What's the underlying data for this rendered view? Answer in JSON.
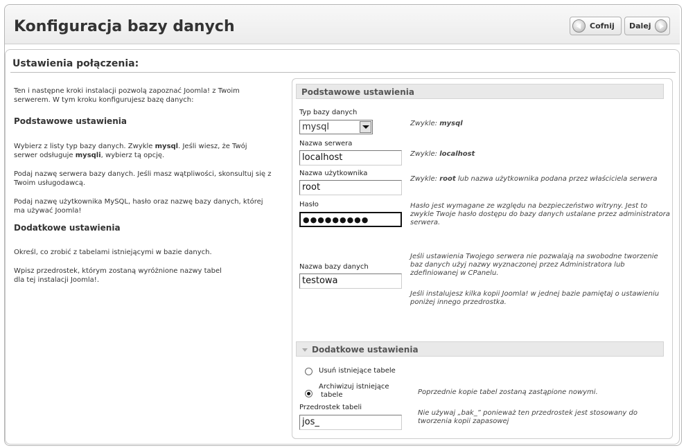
{
  "header": {
    "title": "Konfiguracja bazy danych",
    "back_label": "Cofnij",
    "next_label": "Dalej"
  },
  "section": {
    "title": "Ustawienia połączenia:"
  },
  "left": {
    "intro": "Ten i następne kroki instalacji pozwolą zapoznać Joomla! z Twoim serwerem. W tym kroku konfigurujesz bazę danych:",
    "basic_heading": "Podstawowe ustawienia",
    "p1_a": "Wybierz z listy typ bazy danych. Zwykle ",
    "p1_b": "mysql",
    "p1_c": ". Jeśli wiesz, że Twój serwer odsługuje ",
    "p1_d": "mysqli",
    "p1_e": ", wybierz tą opcję.",
    "p2": "Podaj nazwę serwera bazy danych. Jeśli masz wątpliwości, skonsultuj się z Twoim usługodawcą.",
    "p3": "Podaj nazwę użytkownika MySQL, hasło oraz nazwę bazy danych, której ma używać Joomla!",
    "advanced_heading": "Dodatkowe ustawienia",
    "p4": "Określ, co zrobić z tabelami istniejącymi w bazie danych.",
    "p5_line1": "Wpisz przedrostek, którym zostaną wyróżnione nazwy tabel",
    "p5_line2": "dla tej instalacji Joomla!."
  },
  "basic": {
    "heading": "Podstawowe ustawienia",
    "db_type_label": "Typ bazy danych",
    "db_type_value": "mysql",
    "db_type_hint_a": "Zwykle: ",
    "db_type_hint_b": "mysql",
    "host_label": "Nazwa serwera",
    "host_value": "localhost",
    "host_hint_a": "Zwykle: ",
    "host_hint_b": "localhost",
    "user_label": "Nazwa użytkownika",
    "user_value": "root",
    "user_hint_a": "Zwykle: ",
    "user_hint_b": "root",
    "user_hint_c": " lub nazwa użytkownika podana przez właściciela serwera",
    "password_label": "Hasło",
    "password_value": "●●●●●●●●●",
    "password_hint": "Hasło jest wymagane ze względu na bezpieczeństwo witryny. Jest to zwykle Twoje hasło dostępu do bazy danych ustalane przez administratora serwera.",
    "dbname_label": "Nazwa bazy danych",
    "dbname_value": "testowa",
    "dbname_hint": "Jeśli ustawienia Twojego serwera nie pozwalają na swobodne tworzenie baz danych użyj nazwy wyznaczonej przez Administratora lub zdefiniowanej w CPanelu.",
    "dbname_hint2": "Jeśli instalujesz kilka kopii Joomla! w jednej bazie pamiętaj o ustawieniu poniżej innego przedrostka."
  },
  "advanced": {
    "heading": "Dodatkowe ustawienia",
    "radio_delete_label": "Usuń istniejące tabele",
    "radio_archive_label_1": "Archiwizuj istniejące",
    "radio_archive_label_2": "tabele",
    "radio_archive_hint": "Poprzednie kopie tabel zostaną zastąpione nowymi.",
    "selected_option": "archive",
    "prefix_label": "Przedrostek tabeli",
    "prefix_value": "jos_",
    "prefix_hint": "Nie używaj „bak_” ponieważ ten przedrostek jest stosowany do tworzenia kopii zapasowej"
  }
}
